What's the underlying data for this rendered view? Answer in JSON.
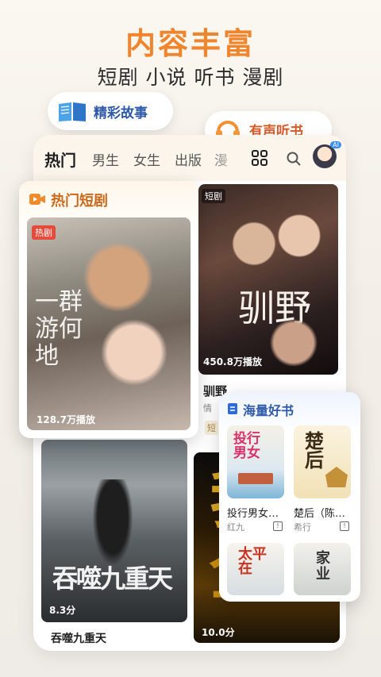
{
  "headline": "内容丰富",
  "subheadline": "短剧 小说 听书 漫剧",
  "badges": {
    "stories": "精彩故事",
    "audio": "有声听书"
  },
  "tabs": [
    "热门",
    "男生",
    "女生",
    "出版",
    "漫"
  ],
  "short_drama_section": {
    "title": "热门短剧",
    "featured": {
      "tag": "热剧",
      "plays": "128.7万播放"
    }
  },
  "grid": {
    "item1": {
      "tag": "短剧",
      "plays": "450.8万播放",
      "title": "驯野",
      "sub": "情",
      "tag2": "短"
    },
    "item2": {
      "score": "8.3分",
      "title": "吞噬九重天"
    },
    "item3": {
      "score": "10.0分"
    }
  },
  "books_section": {
    "title": "海量好书",
    "books": [
      {
        "title": "投行男女…",
        "author": "红九"
      },
      {
        "title": "楚后（陈…",
        "author": "希行"
      },
      {
        "title": "",
        "author": ""
      },
      {
        "title": "",
        "author": ""
      }
    ]
  },
  "colors": {
    "accent": "#f0852d",
    "blue": "#2f5aa8",
    "audio": "#d65b2a"
  },
  "icons": [
    "book-icon",
    "headphones-icon",
    "apps-grid-icon",
    "search-icon",
    "ai-avatar",
    "video-icon",
    "book-list-icon"
  ]
}
